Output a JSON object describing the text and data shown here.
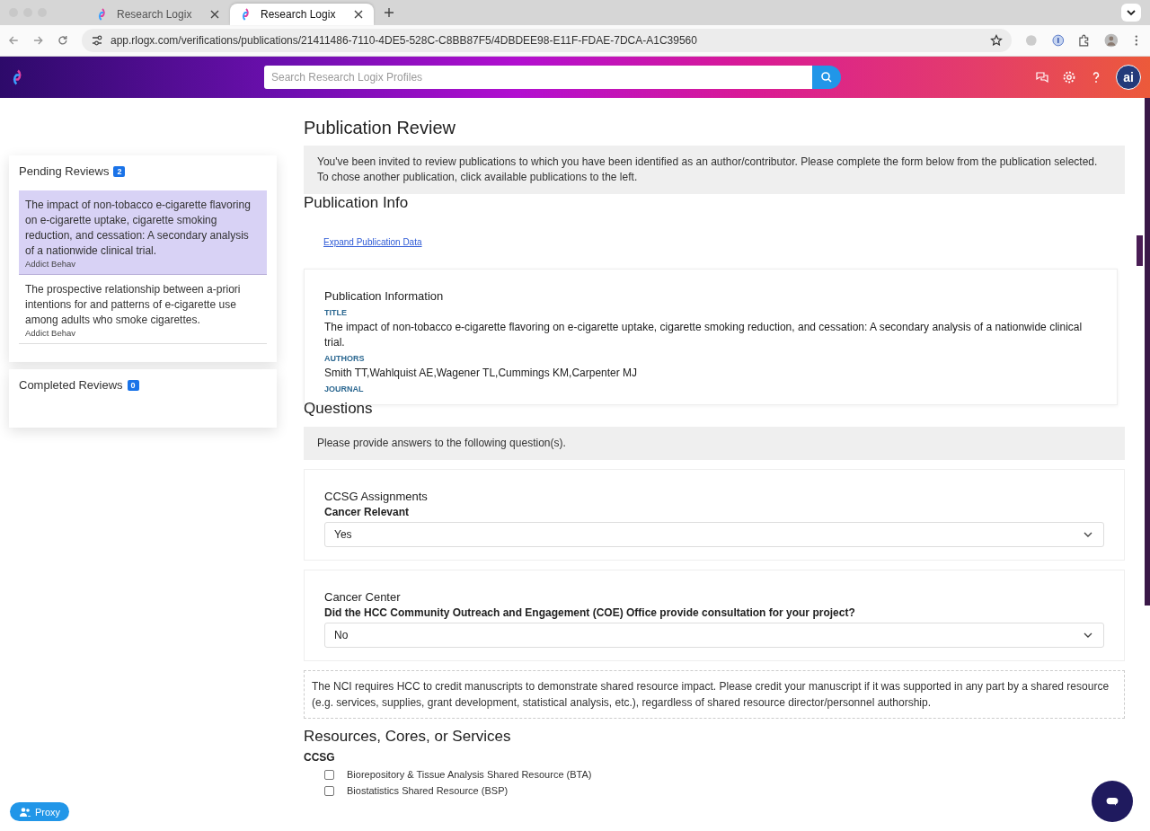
{
  "browser": {
    "tabs": [
      {
        "title": "Research Logix",
        "selected": false
      },
      {
        "title": "Research Logix",
        "selected": true
      }
    ],
    "url": "app.rlogx.com/verifications/publications/21411486-7110-4DE5-528C-C8BB87F5/4DBDEE98-E11F-FDAE-7DCA-A1C39560"
  },
  "header": {
    "search": {
      "placeholder": "Search Research Logix Profiles"
    },
    "avatar": "ai"
  },
  "sidebar": {
    "pending": {
      "title": "Pending Reviews",
      "count": "2",
      "items": [
        {
          "title": "The impact of non-tobacco e-cigarette flavoring on e-cigarette uptake, cigarette smoking reduction, and cessation: A secondary analysis of a nationwide clinical trial.",
          "journal": "Addict Behav",
          "selected": true
        },
        {
          "title": "The prospective relationship between a-priori intentions for and patterns of e-cigarette use among adults who smoke cigarettes.",
          "journal": "Addict Behav",
          "selected": false
        }
      ]
    },
    "completed": {
      "title": "Completed Reviews",
      "count": "0"
    }
  },
  "main": {
    "page_title": "Publication Review",
    "intro": "You've been invited to review publications to which you have been identified as an author/contributor. Please complete the form below from the publication selected. To chose another publication, click available publications to the left.",
    "info_title": "Publication Info",
    "expand_link": "Expand Publication Data",
    "pub_info": {
      "heading": "Publication Information",
      "fields": [
        {
          "label": "TITLE",
          "value": "The impact of non-tobacco e-cigarette flavoring on e-cigarette uptake, cigarette smoking reduction, and cessation: A secondary analysis of a nationwide clinical trial."
        },
        {
          "label": "AUTHORS",
          "value": "Smith TT,Wahlquist AE,Wagener TL,Cummings KM,Carpenter MJ"
        },
        {
          "label": "JOURNAL"
        }
      ]
    },
    "questions": {
      "title": "Questions",
      "prompt": "Please provide answers to the following question(s).",
      "groups": [
        {
          "heading": "CCSG Assignments",
          "question": "Cancer Relevant",
          "value": "Yes"
        },
        {
          "heading": "Cancer Center",
          "question": "Did the HCC Community Outreach and Engagement (COE) Office provide consultation for your project?",
          "value": "No"
        }
      ]
    },
    "notice": "The NCI requires HCC to credit manuscripts to demonstrate shared resource impact. Please credit your manuscript if it was supported in any part by a shared resource (e.g. services, supplies, grant development, statistical analysis, etc.), regardless of shared resource director/personnel authorship.",
    "resources": {
      "title": "Resources, Cores, or Services",
      "group": "CCSG",
      "items": [
        {
          "label": "Biorepository & Tissue Analysis Shared Resource (BTA)",
          "checked": false
        },
        {
          "label": "Biostatistics Shared Resource (BSP)",
          "checked": false
        }
      ]
    }
  },
  "proxy_button": "Proxy"
}
